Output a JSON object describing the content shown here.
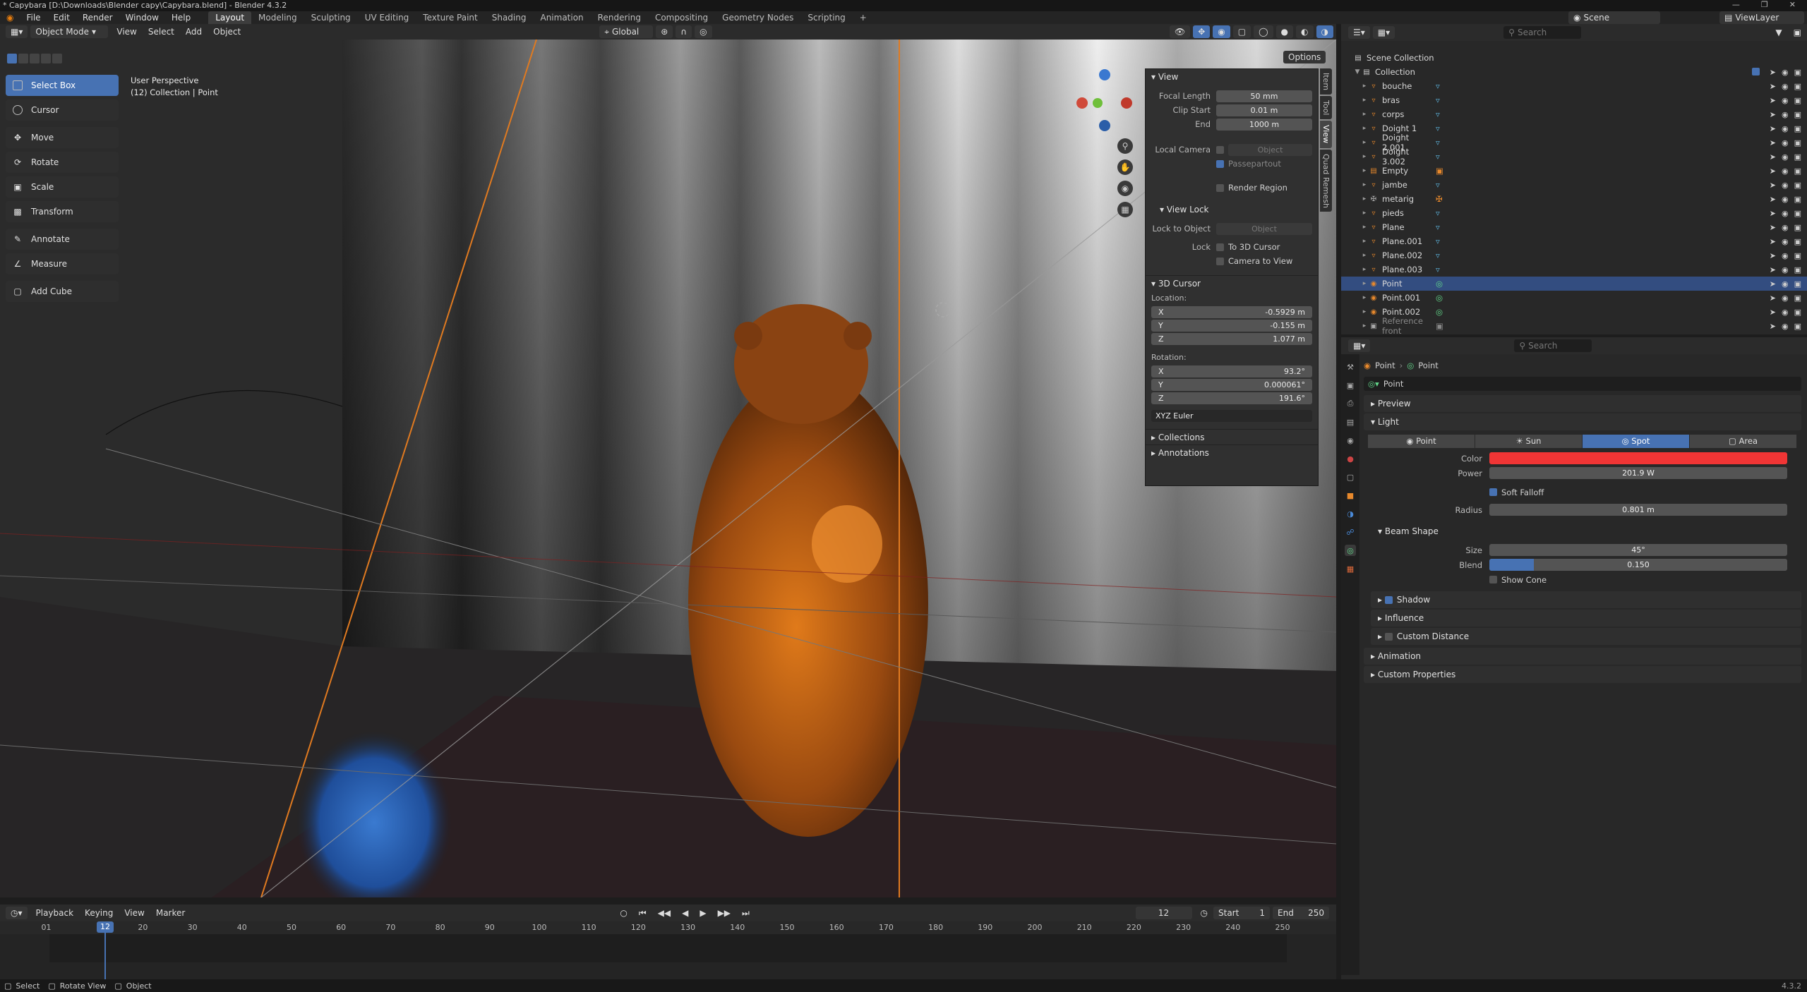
{
  "titlebar": {
    "title": "* Capybara [D:\\Downloads\\Blender capy\\Capybara.blend] - Blender 4.3.2"
  },
  "menus": [
    "File",
    "Edit",
    "Render",
    "Window",
    "Help"
  ],
  "workspaces": [
    "Layout",
    "Modeling",
    "Sculpting",
    "UV Editing",
    "Texture Paint",
    "Shading",
    "Animation",
    "Rendering",
    "Compositing",
    "Geometry Nodes",
    "Scripting"
  ],
  "active_workspace": "Layout",
  "scene": "Scene",
  "viewlayer": "ViewLayer",
  "viewport_header": {
    "mode": "Object Mode",
    "menus": [
      "View",
      "Select",
      "Add",
      "Object"
    ],
    "orientation": "Global",
    "options": "Options"
  },
  "viewport_overlay": {
    "perspective": "User Perspective",
    "collection": "(12) Collection | Point"
  },
  "tools": [
    {
      "label": "Select Box",
      "active": true
    },
    {
      "label": "Cursor"
    },
    {
      "label": "Move"
    },
    {
      "label": "Rotate"
    },
    {
      "label": "Scale"
    },
    {
      "label": "Transform"
    },
    {
      "label": "Annotate"
    },
    {
      "label": "Measure"
    },
    {
      "label": "Add Cube"
    }
  ],
  "npanel": {
    "view_title": "View",
    "focal_label": "Focal Length",
    "focal": "50 mm",
    "clip_start_label": "Clip Start",
    "clip_start": "0.01 m",
    "end_label": "End",
    "clip_end": "1000 m",
    "local_camera_label": "Local Camera",
    "local_camera_placeholder": "Object",
    "passepartout": "Passepartout",
    "render_region": "Render Region",
    "view_lock_title": "View Lock",
    "lock_to_object_label": "Lock to Object",
    "lock_object_placeholder": "Object",
    "lock_label": "Lock",
    "to_3d_cursor": "To 3D Cursor",
    "camera_to_view": "Camera to View",
    "cursor_title": "3D Cursor",
    "location_label": "Location:",
    "rotation_label": "Rotation:",
    "loc": [
      {
        "axis": "X",
        "value": "-0.5929 m"
      },
      {
        "axis": "Y",
        "value": "-0.155 m"
      },
      {
        "axis": "Z",
        "value": "1.077 m"
      }
    ],
    "rot": [
      {
        "axis": "X",
        "value": "93.2°"
      },
      {
        "axis": "Y",
        "value": "0.000061°"
      },
      {
        "axis": "Z",
        "value": "191.6°"
      }
    ],
    "rot_mode": "XYZ Euler",
    "collections": "Collections",
    "annotations": "Annotations",
    "tabs": [
      "Item",
      "Tool",
      "View",
      "Quad Remesh"
    ]
  },
  "timeline": {
    "menus": [
      "Playback",
      "Keying",
      "View",
      "Marker"
    ],
    "current_frame": "12",
    "start_label": "Start",
    "start": "1",
    "end_label": "End",
    "end": "250",
    "ticks": [
      "0",
      "1",
      "20",
      "30",
      "40",
      "50",
      "60",
      "70",
      "80",
      "90",
      "100",
      "110",
      "120",
      "130",
      "140",
      "150",
      "160",
      "170",
      "180",
      "190",
      "200",
      "210",
      "220",
      "230",
      "240",
      "250"
    ]
  },
  "outliner": {
    "search_placeholder": "Search",
    "scene_collection": "Scene Collection",
    "collection": "Collection",
    "items": [
      {
        "name": "bouche",
        "type": "mesh"
      },
      {
        "name": "bras",
        "type": "mesh"
      },
      {
        "name": "corps",
        "type": "mesh"
      },
      {
        "name": "Doight 1",
        "type": "mesh"
      },
      {
        "name": "Doight 2.001",
        "type": "mesh"
      },
      {
        "name": "Doight 3.002",
        "type": "mesh"
      },
      {
        "name": "Empty",
        "type": "empty"
      },
      {
        "name": "jambe",
        "type": "mesh"
      },
      {
        "name": "metarig",
        "type": "armature"
      },
      {
        "name": "pieds",
        "type": "mesh"
      },
      {
        "name": "Plane",
        "type": "mesh"
      },
      {
        "name": "Plane.001",
        "type": "mesh"
      },
      {
        "name": "Plane.002",
        "type": "mesh"
      },
      {
        "name": "Plane.003",
        "type": "mesh"
      },
      {
        "name": "Point",
        "type": "light",
        "selected": true
      },
      {
        "name": "Point.001",
        "type": "light"
      },
      {
        "name": "Point.002",
        "type": "light"
      },
      {
        "name": "Reference front",
        "type": "image"
      }
    ]
  },
  "properties": {
    "search_placeholder": "Search",
    "breadcrumb": [
      "Point",
      "Point"
    ],
    "datablock": "Point",
    "preview": "Preview",
    "light": "Light",
    "light_types": [
      "Point",
      "Sun",
      "Spot",
      "Area"
    ],
    "active_type": "Spot",
    "color_label": "Color",
    "color": "#f03535",
    "power_label": "Power",
    "power": "201.9 W",
    "soft_falloff": "Soft Falloff",
    "radius_label": "Radius",
    "radius": "0.801 m",
    "beam_shape": "Beam Shape",
    "size_label": "Size",
    "size": "45°",
    "blend_label": "Blend",
    "blend": "0.150",
    "blend_fraction": 0.15,
    "show_cone": "Show Cone",
    "shadow": "Shadow",
    "influence": "Influence",
    "custom_distance": "Custom Distance",
    "animation": "Animation",
    "custom_properties": "Custom Properties"
  },
  "statusbar": {
    "items": [
      "Select",
      "Rotate View",
      "Object"
    ],
    "version": "4.3.2"
  }
}
